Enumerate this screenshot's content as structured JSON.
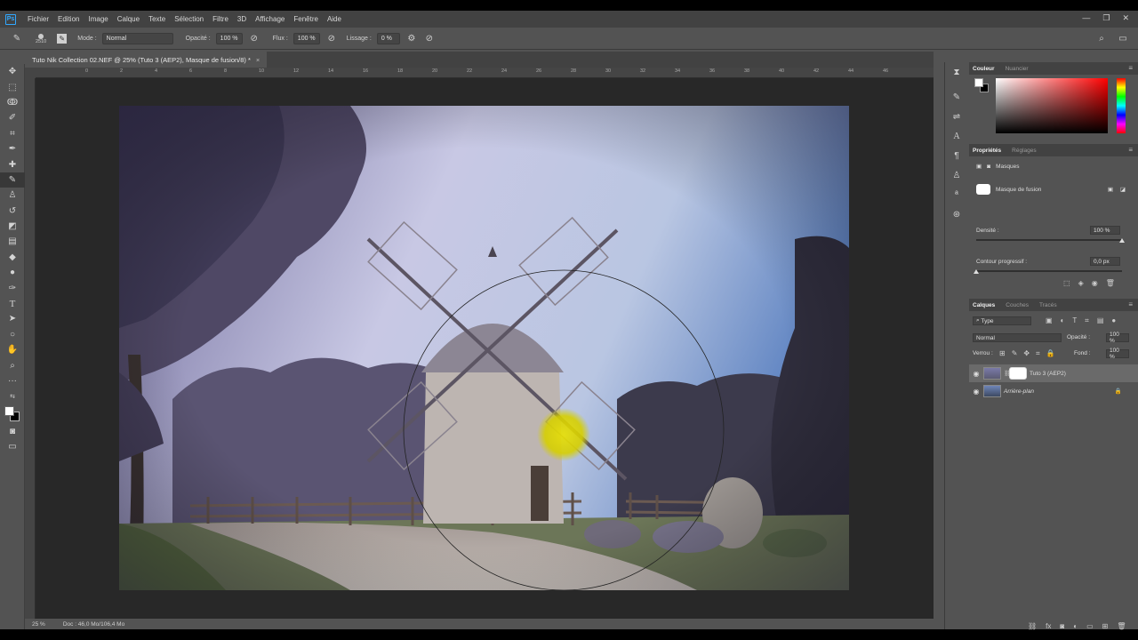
{
  "menu": {
    "items": [
      "Fichier",
      "Edition",
      "Image",
      "Calque",
      "Texte",
      "Sélection",
      "Filtre",
      "3D",
      "Affichage",
      "Fenêtre",
      "Aide"
    ],
    "logo": "Ps"
  },
  "options": {
    "brush_size": "2510",
    "mode_label": "Mode :",
    "mode_value": "Normal",
    "opacity_label": "Opacité :",
    "opacity_value": "100 %",
    "flow_label": "Flux :",
    "flow_value": "100 %",
    "smoothing_label": "Lissage :",
    "smoothing_value": "0 %"
  },
  "document": {
    "tab_title": "Tuto Nik Collection 02.NEF @ 25% (Tuto 3 (AEP2), Masque de fusion/8) *",
    "ruler_top": [
      "0",
      "2",
      "4",
      "6",
      "8",
      "10",
      "12",
      "14",
      "16",
      "18",
      "20",
      "22",
      "24",
      "26",
      "28",
      "30",
      "32",
      "34",
      "36",
      "38",
      "40",
      "42",
      "44",
      "46"
    ]
  },
  "status": {
    "zoom": "25 %",
    "doc_info": "Doc : 46,0 Mo/106,4 Mo"
  },
  "color_panel": {
    "tab_active": "Couleur",
    "tab_other": "Nuancier",
    "fg": "#ffffff",
    "bg": "#000000"
  },
  "properties": {
    "tab_active": "Propriétés",
    "tab_other": "Réglages",
    "section": "Masques",
    "mask_label": "Masque de fusion",
    "density_label": "Densité :",
    "density_value": "100 %",
    "density_fraction": 1.0,
    "feather_label": "Contour progressif :",
    "feather_value": "0,0 px",
    "feather_fraction": 0.0
  },
  "layers": {
    "tabs": [
      "Calques",
      "Couches",
      "Tracés"
    ],
    "filter": "Type",
    "blend_mode": "Normal",
    "opacity_label": "Opacité :",
    "opacity_value": "100 %",
    "lock_label": "Verrou :",
    "fill_label": "Fond :",
    "fill_value": "100 %",
    "items": [
      {
        "name": "Tuto 3 (AEP2)",
        "selected": true
      },
      {
        "name": "Arrière-plan",
        "selected": false
      }
    ]
  },
  "window": {
    "minimize": "—",
    "restore": "❐",
    "close": "✕"
  }
}
